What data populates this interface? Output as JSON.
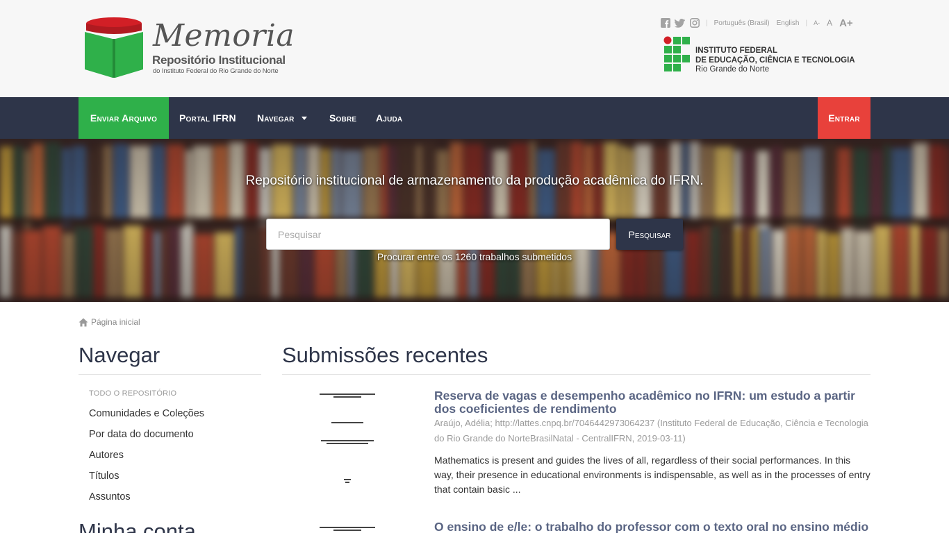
{
  "header": {
    "logo": {
      "title": "Memoria",
      "subtitle": "Repositório Institucional",
      "subtitle2": "do Instituto Federal do Rio Grande do Norte"
    },
    "toplinks": {
      "social": [
        "facebook-icon",
        "twitter-icon",
        "instagram-icon"
      ],
      "lang_pt": "Português (Brasil)",
      "lang_en": "English",
      "font_smaller": "A-",
      "font_normal": "A",
      "font_larger": "A+"
    },
    "institution": {
      "line1": "INSTITUTO FEDERAL",
      "line2": "DE EDUCAÇÃO, CIÊNCIA E TECNOLOGIA",
      "line3": "Rio Grande do Norte"
    }
  },
  "nav": {
    "send": "Enviar Arquivo",
    "portal": "Portal IFRN",
    "browse": "Navegar",
    "about": "Sobre",
    "help": "Ajuda",
    "login": "Entrar"
  },
  "hero": {
    "tagline": "Repositório institucional de armazenamento da produção acadêmica do IFRN.",
    "search_placeholder": "Pesquisar",
    "search_button": "Pesquisar",
    "search_help": "Procurar entre os 1260 trabalhos submetidos"
  },
  "breadcrumb": {
    "home": "Página inicial"
  },
  "sidebar": {
    "title": "Navegar",
    "subtitle": "Todo o repositório",
    "items": [
      "Comunidades e Coleções",
      "Por data do documento",
      "Autores",
      "Títulos",
      "Assuntos"
    ],
    "title2": "Minha conta"
  },
  "main": {
    "title": "Submissões recentes",
    "items": [
      {
        "title": "Reserva de vagas e desempenho acadêmico no IFRN: um estudo a partir dos coeficientes de rendimento",
        "meta": "Araújo, Adélia; http://lattes.cnpq.br/7046442973064237 (Instituto Federal de Educação, Ciência e Tecnologia do Rio Grande do NorteBrasilNatal - CentralIFRN, 2019-03-11)",
        "abstract": "Mathematics is present and guides the lives of all, regardless of their social performances. In this way, their presence in educational environments is indispensable, as well as in the processes of entry that contain basic ..."
      },
      {
        "title": "O ensino de e/le: o trabalho do professor com o texto oral no ensino médio"
      }
    ]
  },
  "colors": {
    "navbar": "#2e3549",
    "send_button": "#2fb04a",
    "login_button": "#e8413b",
    "link": "#5a6583",
    "logo_green": "#2fb04a",
    "logo_red": "#d21f26"
  }
}
